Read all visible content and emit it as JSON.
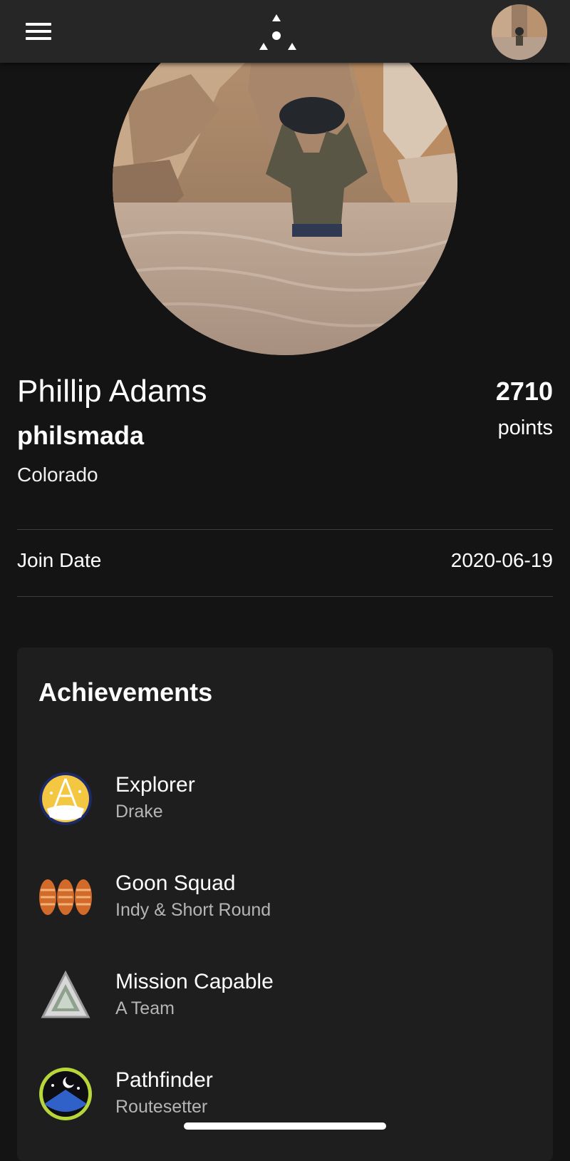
{
  "header": {
    "menu_icon": "hamburger-menu-icon",
    "logo_icon": "triangle-dots-logo"
  },
  "profile": {
    "name": "Phillip Adams",
    "username": "philsmada",
    "location": "Colorado",
    "points": "2710",
    "points_label": "points"
  },
  "details": {
    "join_label": "Join Date",
    "join_value": "2020-06-19"
  },
  "achievements": {
    "title": "Achievements",
    "items": [
      {
        "title": "Explorer",
        "subtitle": "Drake",
        "icon": "explorer-badge-icon"
      },
      {
        "title": "Goon Squad",
        "subtitle": "Indy & Short Round",
        "icon": "goon-squad-badge-icon"
      },
      {
        "title": "Mission Capable",
        "subtitle": "A Team",
        "icon": "mission-capable-badge-icon"
      },
      {
        "title": "Pathfinder",
        "subtitle": "Routesetter",
        "icon": "pathfinder-badge-icon"
      }
    ]
  },
  "colors": {
    "background": "#141414",
    "topbar": "#262626",
    "card": "#1e1e1e",
    "subtitle": "#b5b5b5"
  }
}
